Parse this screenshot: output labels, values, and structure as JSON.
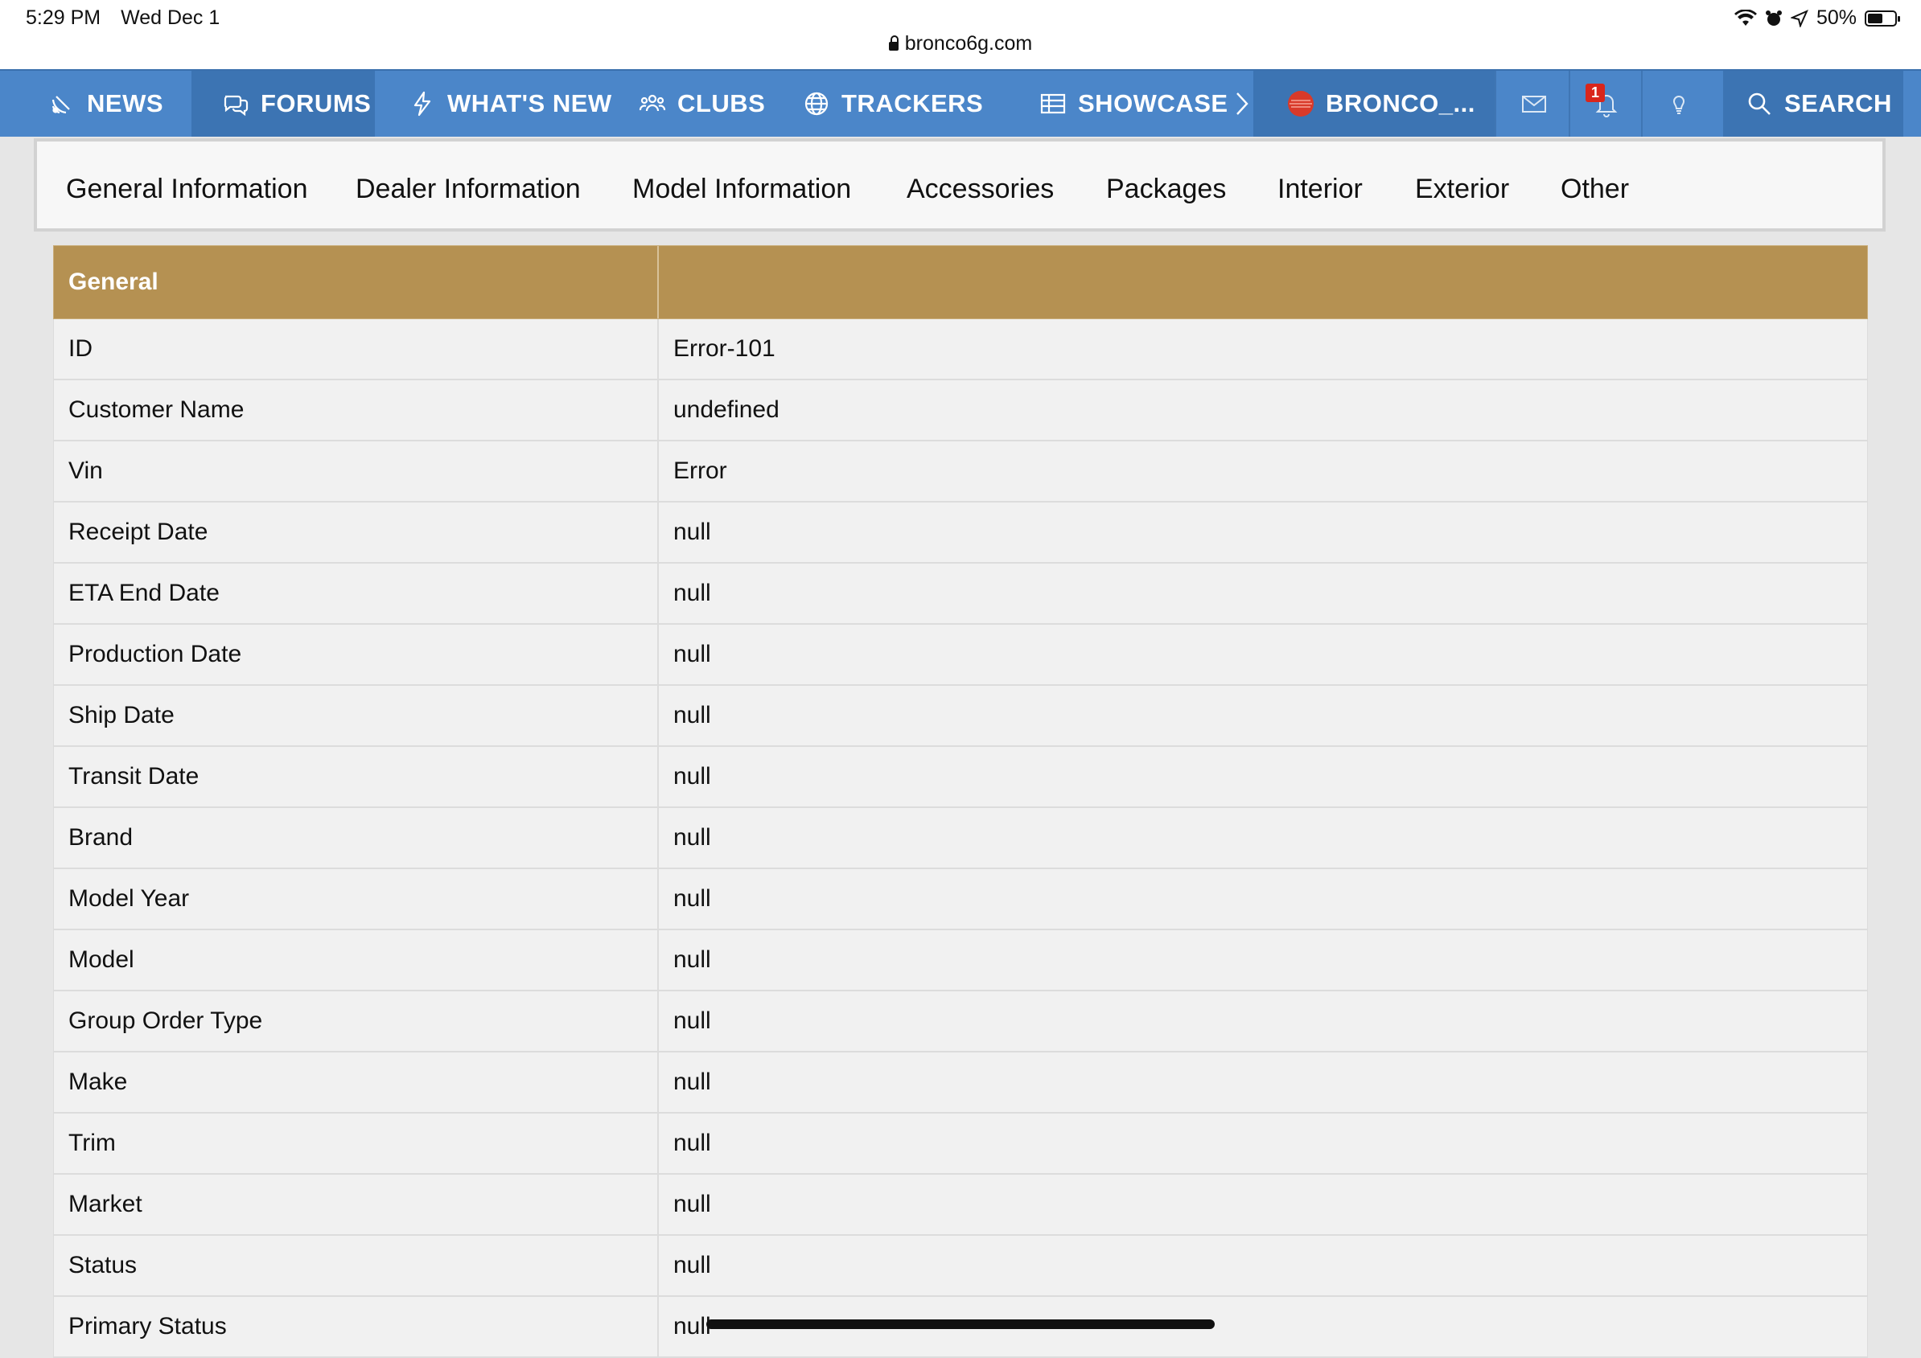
{
  "status_bar": {
    "time": "5:29 PM",
    "date": "Wed Dec 1",
    "url": "bronco6g.com",
    "battery": "50%",
    "icons": [
      "wifi-icon",
      "alarm-icon",
      "location-icon",
      "battery-icon"
    ]
  },
  "nav": {
    "news": "NEWS",
    "forums": "FORUMS",
    "whats_new": "WHAT'S NEW",
    "clubs": "CLUBS",
    "trackers": "TRACKERS",
    "showcase": "SHOWCASE",
    "user": "BRONCO_...",
    "alerts_count": "1",
    "search": "SEARCH",
    "colors": {
      "bar": "#4b86c9",
      "active": "#1f3f66",
      "badge": "#d9261c"
    }
  },
  "tabs": [
    "General Information",
    "Dealer Information",
    "Model Information",
    "Accessories",
    "Packages",
    "Interior",
    "Exterior",
    "Other"
  ],
  "table": {
    "header": [
      "General",
      ""
    ],
    "header_color": "#b59152",
    "rows": [
      [
        "ID",
        "Error-101"
      ],
      [
        "Customer Name",
        "undefined"
      ],
      [
        "Vin",
        "Error"
      ],
      [
        "Receipt Date",
        "null"
      ],
      [
        "ETA End Date",
        "null"
      ],
      [
        "Production Date",
        "null"
      ],
      [
        "Ship Date",
        "null"
      ],
      [
        "Transit Date",
        "null"
      ],
      [
        "Brand",
        "null"
      ],
      [
        "Model Year",
        "null"
      ],
      [
        "Model",
        "null"
      ],
      [
        "Group Order Type",
        "null"
      ],
      [
        "Make",
        "null"
      ],
      [
        "Trim",
        "null"
      ],
      [
        "Market",
        "null"
      ],
      [
        "Status",
        "null"
      ],
      [
        "Primary Status",
        "null"
      ]
    ]
  }
}
